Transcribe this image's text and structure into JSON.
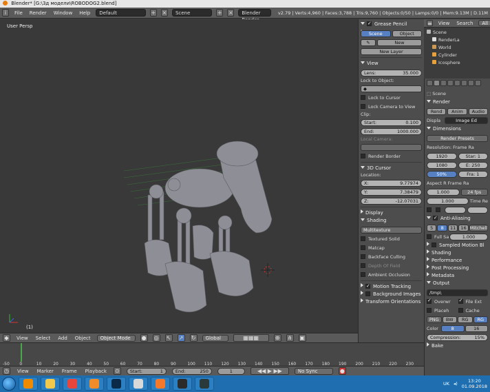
{
  "window": {
    "title": "Blender* [G:\\3д модели\\ROBODOG2.blend]"
  },
  "infobar": {
    "menus": [
      "File",
      "Render",
      "Window",
      "Help"
    ],
    "screen_layout": "Default",
    "scene": "Scene",
    "engine": "Blender Render",
    "stats": "v2.79 | Verts:4,960 | Faces:3,788 | Tris:9,760 | Objects:0/50 | Lamps:0/0 | Mem:9.13M | D.11M"
  },
  "viewport": {
    "label": "User Persp",
    "frame": "(1)"
  },
  "vp_header": {
    "menus": [
      "View",
      "Select",
      "Add",
      "Object"
    ],
    "mode": "Object Mode",
    "orientation": "Global"
  },
  "timeline": {
    "ticks": [
      "-50",
      "0",
      "10",
      "20",
      "30",
      "40",
      "50",
      "60",
      "70",
      "80",
      "90",
      "100",
      "110",
      "120",
      "130",
      "140",
      "150",
      "160",
      "170",
      "180",
      "190",
      "200",
      "210",
      "220",
      "230"
    ],
    "menus": [
      "View",
      "Marker",
      "Frame",
      "Playback"
    ],
    "start_label": "Start:",
    "start_value": "1",
    "end_label": "End:",
    "end_value": "250",
    "current": "1",
    "sync": "No Sync"
  },
  "props_panel": {
    "grease_title": "Grease Pencil Layers",
    "tab_scene": "Scene",
    "tab_object": "Object",
    "new_label": "New",
    "new_layer_label": "New Layer",
    "view_title": "View",
    "lens_label": "Lens:",
    "lens_value": "35.000",
    "lock_to_object": "Lock to Object:",
    "lock_to_cursor": "Lock to Cursor",
    "lock_camera": "Lock Camera to View",
    "clip_label": "Clip:",
    "clip_start_label": "Start:",
    "clip_start_value": "0.100",
    "clip_end_label": "End:",
    "clip_end_value": "1000.000",
    "local_camera": "Local Camera:",
    "render_border": "Render Border",
    "cursor_title": "3D Cursor",
    "location_label": "Location:",
    "x_label": "X:",
    "x_value": "9.77974",
    "y_label": "Y:",
    "y_value": "7.38479",
    "z_label": "Z:",
    "z_value": "-12.07031",
    "display_title": "Display",
    "shading_title": "Shading",
    "shading_mode": "Multitexture",
    "textured_solid": "Textured Solid",
    "matcap": "Matcap",
    "backface_culling": "Backface Culling",
    "depth_of_field": "Depth Of Field",
    "ambient_occlusion": "Ambient Occlusion",
    "motion_tracking": "Motion Tracking",
    "background_images": "Background Images",
    "transform_orientations": "Transform Orientations"
  },
  "outliner": {
    "tabs": [
      "View",
      "Search",
      "All"
    ],
    "items": [
      "Scene",
      "RenderLa",
      "World",
      "Cylinder",
      "Icosphere"
    ]
  },
  "render_panel": {
    "scene_label": "Scene",
    "render_title": "Render",
    "render_btns": [
      "Rend",
      "Anim",
      "Audio"
    ],
    "display_label": "Displa",
    "display_value": "Image Ed",
    "dimensions_title": "Dimensions",
    "presets": "Render Presets",
    "resolution_label": "Resolution:",
    "frame_range_label": "Frame Ra",
    "res_x": "1920",
    "res_y": "1080",
    "res_pct": "50%",
    "frame_start": "Star: 1",
    "frame_end": "E: 250",
    "frame_step": "Fra: 1",
    "aspect_label": "Aspect R",
    "frame_rate_label": "Frame Ra",
    "aspect_x": "1.000",
    "aspect_y": "1.000",
    "fps": "24 fps",
    "time_label": "Time Re",
    "aa_title": "Anti-Aliasing",
    "aa_samples": [
      "5",
      "8",
      "11",
      "16"
    ],
    "aa_filter": "Mitchell",
    "full_sample": "Full Sa",
    "aa_size": "1.000",
    "sampled_motion": "Sampled Motion Bl",
    "shading": "Shading",
    "performance": "Performance",
    "post_processing": "Post Processing",
    "metadata": "Metadata",
    "output": "Output",
    "output_path": "/tmp\\",
    "overwrite": "Overwr",
    "file_ext": "File Ext",
    "placeholders": "Placeh",
    "cache": "Cache",
    "format": "PNG",
    "color_modes": [
      "BW",
      "RG",
      "RG"
    ],
    "color_label": "Color",
    "color_depth": [
      "8",
      "16"
    ],
    "compression_label": "Compression:",
    "compression_value": "15%",
    "bake": "Bake"
  },
  "taskbar": {
    "lang": "UK",
    "time": "13:20",
    "date": "01.09.2018",
    "apps": [
      {
        "name": "vlc-icon",
        "color": "#f08a00"
      },
      {
        "name": "explorer-icon",
        "color": "#f2c94c"
      },
      {
        "name": "chrome-icon",
        "color": "#e8453c"
      },
      {
        "name": "avast-icon",
        "color": "#f28c28"
      },
      {
        "name": "photoshop-icon",
        "color": "#0b2a4a"
      },
      {
        "name": "files-icon",
        "color": "#d9d9d9"
      },
      {
        "name": "blender-icon",
        "color": "#f5792a"
      },
      {
        "name": "obs-icon",
        "color": "#2b2b2b"
      },
      {
        "name": "app-icon",
        "color": "#2a3a3a"
      }
    ]
  }
}
